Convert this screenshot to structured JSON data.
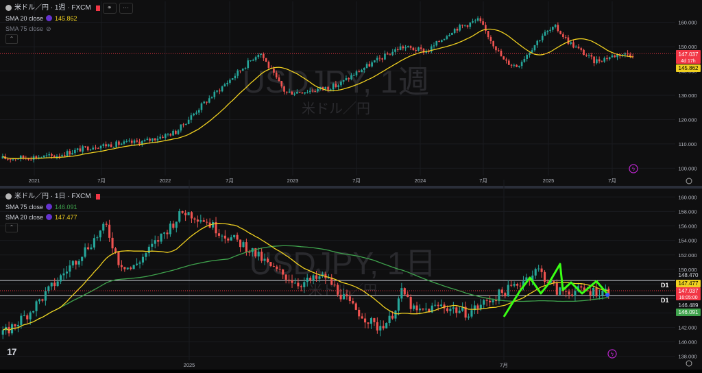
{
  "weekly": {
    "symbol_label": "米ドル／円 · 1週 · FXCM",
    "sma1": {
      "label": "SMA 20 close",
      "value": "145.862",
      "color": "#f0d020"
    },
    "sma2": {
      "label": "SMA 75 close"
    },
    "watermark": "USDJPY, 1週",
    "watermark_sub": "米ドル／円",
    "price_ticks": [
      "160.000",
      "150.000",
      "140.000",
      "130.000",
      "120.000",
      "110.000",
      "100.000"
    ],
    "time_ticks": [
      "2021",
      "7月",
      "2022",
      "7月",
      "2023",
      "7月",
      "2024",
      "7月",
      "2025",
      "7月"
    ],
    "badges": {
      "price": "147.037",
      "countdown": "4d 17h",
      "sma": "145.862"
    }
  },
  "daily": {
    "symbol_label": "米ドル／円 · 1日 · FXCM",
    "sma1": {
      "label": "SMA 75 close",
      "value": "146.091",
      "color": "#3fa34d"
    },
    "sma2": {
      "label": "SMA 20 close",
      "value": "147.477",
      "color": "#f0d020"
    },
    "watermark": "USDJPY, 1日",
    "watermark_sub": "米ドル／円",
    "price_ticks": [
      "160.000",
      "158.000",
      "156.000",
      "154.000",
      "152.000",
      "150.000",
      "148.000",
      "146.000",
      "144.000",
      "142.000",
      "140.000",
      "138.000"
    ],
    "time_ticks": [
      "2025",
      "7月"
    ],
    "badges": {
      "line_top": "148.470",
      "sma20": "147.477",
      "price": "147.037",
      "countdown": "16:05:00",
      "line_bottom": "146.489",
      "sma75": "146.091"
    },
    "d1_label": "D1"
  },
  "colors": {
    "up": "#26a69a",
    "down": "#ef5350",
    "sma20": "#f0d020",
    "sma75": "#3fa34d",
    "drawing": "#39ff14",
    "price_badge": "#f23645"
  },
  "chart_data": [
    {
      "type": "candlestick",
      "title": "米ドル／円 · 1週 · FXCM",
      "ylim": [
        97,
        163
      ],
      "x": [
        "2021",
        "7月",
        "2022",
        "7月",
        "2023",
        "7月",
        "2024",
        "7月",
        "2025",
        "7月"
      ],
      "close_path": [
        [
          0,
          104
        ],
        [
          8,
          105
        ],
        [
          14,
          109
        ],
        [
          18,
          110
        ],
        [
          22,
          111
        ],
        [
          27,
          115
        ],
        [
          31,
          126
        ],
        [
          36,
          138
        ],
        [
          40,
          148
        ],
        [
          42,
          139
        ],
        [
          44,
          131
        ],
        [
          48,
          132
        ],
        [
          52,
          134
        ],
        [
          56,
          141
        ],
        [
          60,
          147
        ],
        [
          62,
          150
        ],
        [
          66,
          148
        ],
        [
          70,
          157
        ],
        [
          74,
          161
        ],
        [
          78,
          144
        ],
        [
          80,
          142
        ],
        [
          84,
          155
        ],
        [
          86,
          158
        ],
        [
          88,
          152
        ],
        [
          92,
          144
        ],
        [
          96,
          147
        ],
        [
          98,
          147
        ]
      ],
      "series": [
        {
          "name": "SMA 20 close",
          "last": 145.862
        }
      ],
      "last_price": 147.037
    },
    {
      "type": "candlestick",
      "title": "米ドル／円 · 1日 · FXCM",
      "ylim": [
        137.5,
        160.5
      ],
      "x": [
        "2025",
        "7月"
      ],
      "close_path": [
        [
          0,
          141
        ],
        [
          4,
          144
        ],
        [
          8,
          148
        ],
        [
          12,
          152
        ],
        [
          16,
          156
        ],
        [
          18,
          151
        ],
        [
          20,
          150
        ],
        [
          24,
          154
        ],
        [
          28,
          158
        ],
        [
          31,
          157
        ],
        [
          34,
          155
        ],
        [
          38,
          153
        ],
        [
          42,
          150
        ],
        [
          46,
          148
        ],
        [
          50,
          149
        ],
        [
          54,
          145
        ],
        [
          58,
          142
        ],
        [
          60,
          143
        ],
        [
          62,
          147
        ],
        [
          64,
          144
        ],
        [
          68,
          145
        ],
        [
          72,
          144
        ],
        [
          76,
          146
        ],
        [
          80,
          148
        ],
        [
          83,
          150
        ],
        [
          86,
          147
        ],
        [
          90,
          147
        ],
        [
          94,
          147
        ]
      ],
      "series": [
        {
          "name": "SMA 75 close",
          "last": 146.091
        },
        {
          "name": "SMA 20 close",
          "last": 147.477
        }
      ],
      "levels": [
        148.47,
        146.489
      ],
      "last_price": 147.037
    }
  ]
}
